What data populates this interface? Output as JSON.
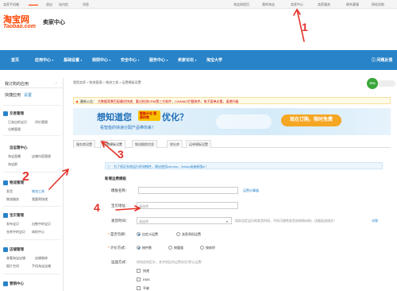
{
  "topbar": {
    "seller": "卖家手机端",
    "logout": "退出",
    "site_msg": "站内信",
    "message": "消息",
    "home": "淘宝网首页",
    "my_taobao": "我的淘宝",
    "seller_center": "卖家中心",
    "seller_service": "卖家服务",
    "help": "联系客服",
    "sitemap": "网站导航"
  },
  "header": {
    "logo_cn": "淘宝网",
    "logo_en": "Taobao.com",
    "title": "卖家中心"
  },
  "nav": {
    "items": [
      "首页",
      "应用中心",
      "基础设置",
      "规则中心",
      "安全中心",
      "服务中心",
      "卖家论坛",
      "淘宝大学"
    ],
    "right": "问题反馈"
  },
  "sidebar": {
    "my_apps": "我订购的应用",
    "quick_apps": "快捷应用",
    "quick_setting": "设置",
    "sections": [
      {
        "title": "交易管理",
        "links": [
          "已卖出的宝贝",
          "评价管理",
          "分期管理"
        ]
      },
      {
        "title": "自运营中心",
        "links": [
          "淘宝直播",
          "店铺内容管理",
          "淘宝群"
        ]
      },
      {
        "title": "物流管理",
        "links": [
          "发货",
          "物流工具",
          "物流服务",
          "我要寄快递"
        ]
      },
      {
        "title": "宝贝管理",
        "links": [
          "发布宝贝",
          "出售中的宝贝",
          "仓库中的宝贝",
          "体检中心"
        ]
      },
      {
        "title": "店铺管理",
        "links": [
          "查看淘宝店铺",
          "店铺装修",
          "图片空间",
          "手机淘宝店铺"
        ]
      },
      {
        "title": "营销中心",
        "links": []
      }
    ]
  },
  "main": {
    "breadcrumb": "我是卖家 > 物流管理 > 物流工具 > 运费模板设置",
    "notice_label": "最新公告：",
    "notice_text": "大数据背景匹配最优快递，勤记检测CRM第三方软件，CAINIAO拦截快件，电子面单必看，速递升级",
    "banner": {
      "badge": "智能分仓 提高时效",
      "headline_a": "想知道您",
      "headline_b": "优化？",
      "sub": "看智能的快递分配产品带你来！",
      "cta": "现在订购，限时免费"
    },
    "tabs": [
      "服务商设置",
      "运费模板设置",
      "物流跟踪信息",
      "地址库",
      "运单模板设置"
    ],
    "active_tab": 1,
    "info": "为了保证系统运行的流畅性，建议使用chrome，firefox或者新版ie！",
    "form": {
      "section_title": "新增运费模板",
      "name_label": "模板名称：",
      "calc_link": "运费计算器",
      "address_label": "宝贝地址：",
      "address_placeholder": "请选择",
      "ship_time_label": "发货时间：",
      "ship_time_placeholder": "请选择",
      "ship_time_hint": "如实设定宝贝的发货时间，不仅可避免发货咨询和纠纷，还能促进成交！",
      "ship_time_link": "详情",
      "free_label": "是否包邮：",
      "free_options": [
        "自定义运费",
        "卖家承担运费"
      ],
      "calc_label": "计价方式：",
      "calc_options": [
        "按件数",
        "按重量",
        "按体积"
      ],
      "delivery_label": "运送方式：",
      "delivery_hint": "除指定地区外，其余地区的运费采用\"默认运费\"",
      "delivery_options": [
        "快递",
        "EMS",
        "平邮"
      ]
    }
  },
  "annotations": {
    "step1": "1",
    "step2": "2",
    "step3": "3",
    "step4": "4"
  },
  "speed": "70%",
  "colors": {
    "brand": "#ff4400",
    "nav": "#2883c8",
    "annotation": "#e4322b"
  }
}
